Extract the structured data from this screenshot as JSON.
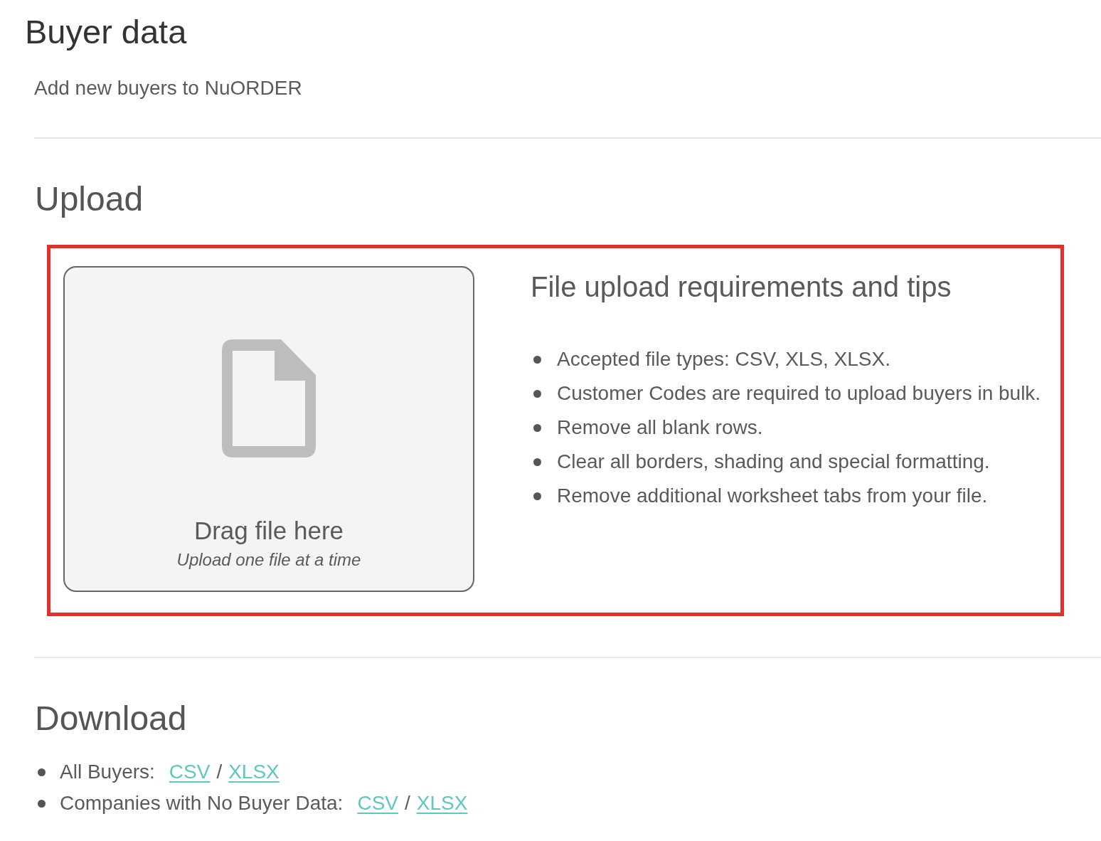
{
  "page": {
    "title": "Buyer data",
    "subtitle": "Add new buyers to NuORDER"
  },
  "upload": {
    "heading": "Upload",
    "highlighted": true,
    "dropzone": {
      "title": "Drag file here",
      "hint": "Upload one file at a time"
    },
    "tips": {
      "heading": "File upload requirements and tips",
      "items": [
        "Accepted file types: CSV, XLS, XLSX.",
        "Customer Codes are required to upload buyers in bulk.",
        "Remove all blank rows.",
        "Clear all borders, shading and special formatting.",
        "Remove additional worksheet tabs from your file."
      ]
    }
  },
  "download": {
    "heading": "Download",
    "items": [
      {
        "label": "All Buyers:",
        "links": [
          "CSV",
          "XLSX"
        ],
        "separator": "/"
      },
      {
        "label": "Companies with No Buyer Data:",
        "links": [
          "CSV",
          "XLSX"
        ],
        "separator": "/"
      }
    ]
  }
}
